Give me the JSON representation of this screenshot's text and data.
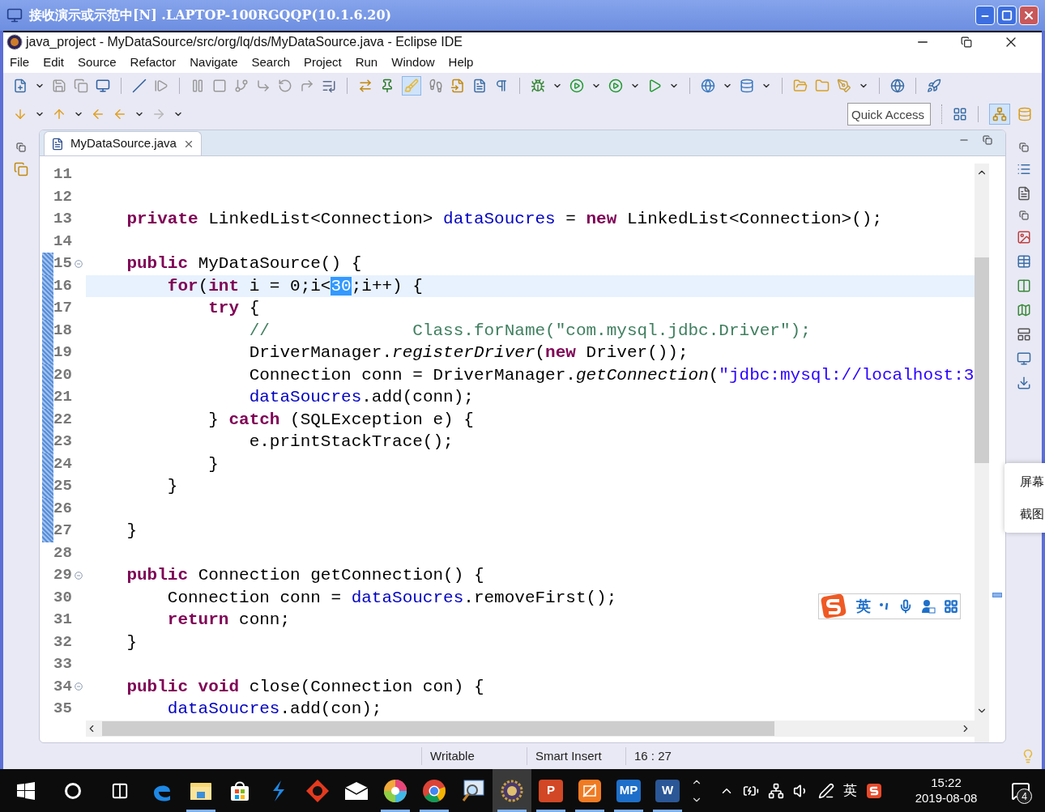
{
  "remote_title": "接收演示或示范中[N] .LAPTOP-100RGQQP(10.1.6.20)",
  "window": {
    "title": "java_project - MyDataSource/src/org/lq/ds/MyDataSource.java - Eclipse IDE"
  },
  "menu": [
    "File",
    "Edit",
    "Source",
    "Refactor",
    "Navigate",
    "Search",
    "Project",
    "Run",
    "Window",
    "Help"
  ],
  "highlight_toggle": {
    "on": true
  },
  "quick_access": {
    "placeholder": "Quick Access"
  },
  "editor_tab": {
    "label": "MyDataSource.java",
    "selected": true
  },
  "code": {
    "lines": [
      {
        "number": "11",
        "changed": false,
        "foldable": false,
        "current": false
      },
      {
        "number": "12",
        "changed": false,
        "foldable": false,
        "current": false
      },
      {
        "number": "13",
        "changed": false,
        "foldable": false,
        "current": false,
        "tokens": [
          {
            "kind": "kw",
            "text": "    private"
          },
          {
            "kind": "plain",
            "text": " LinkedList<Connection> "
          },
          {
            "kind": "field",
            "text": "dataSoucres"
          },
          {
            "kind": "plain",
            "text": " = "
          },
          {
            "kind": "kw",
            "text": "new"
          },
          {
            "kind": "plain",
            "text": " LinkedList<Connection>();"
          }
        ]
      },
      {
        "number": "14",
        "changed": false,
        "foldable": false,
        "current": false
      },
      {
        "number": "15",
        "changed": true,
        "foldable": true,
        "current": false,
        "tokens": [
          {
            "kind": "kw",
            "text": "    public"
          },
          {
            "kind": "plain",
            "text": " MyDataSource() {"
          }
        ]
      },
      {
        "number": "16",
        "changed": true,
        "foldable": false,
        "current": true,
        "tokens": [
          {
            "kind": "kw",
            "text": "        for"
          },
          {
            "kind": "plain",
            "text": "("
          },
          {
            "kind": "kw",
            "text": "int"
          },
          {
            "kind": "plain",
            "text": " i = 0;i<"
          },
          {
            "kind": "sel",
            "text": "30"
          },
          {
            "kind": "plain",
            "text": ";i++) {"
          }
        ]
      },
      {
        "number": "17",
        "changed": true,
        "foldable": false,
        "current": false,
        "tokens": [
          {
            "kind": "kw",
            "text": "            try"
          },
          {
            "kind": "plain",
            "text": " {"
          }
        ]
      },
      {
        "number": "18",
        "changed": true,
        "foldable": false,
        "current": false,
        "tokens": [
          {
            "kind": "comment",
            "text": "                //              Class.forName(\"com.mysql.jdbc.Driver\");"
          }
        ]
      },
      {
        "number": "19",
        "changed": true,
        "foldable": false,
        "current": false,
        "tokens": [
          {
            "kind": "plain",
            "text": "                DriverManager."
          },
          {
            "kind": "italic",
            "text": "registerDriver"
          },
          {
            "kind": "plain",
            "text": "("
          },
          {
            "kind": "kw",
            "text": "new"
          },
          {
            "kind": "plain",
            "text": " Driver());"
          }
        ]
      },
      {
        "number": "20",
        "changed": true,
        "foldable": false,
        "current": false,
        "tokens": [
          {
            "kind": "plain",
            "text": "                Connection conn = DriverManager."
          },
          {
            "kind": "italic",
            "text": "getConnection"
          },
          {
            "kind": "plain",
            "text": "("
          },
          {
            "kind": "str",
            "text": "\"jdbc:mysql://localhost:3"
          }
        ]
      },
      {
        "number": "21",
        "changed": true,
        "foldable": false,
        "current": false,
        "tokens": [
          {
            "kind": "field",
            "text": "                dataSoucres"
          },
          {
            "kind": "plain",
            "text": ".add(conn);"
          }
        ]
      },
      {
        "number": "22",
        "changed": true,
        "foldable": false,
        "current": false,
        "tokens": [
          {
            "kind": "plain",
            "text": "            } "
          },
          {
            "kind": "kw",
            "text": "catch"
          },
          {
            "kind": "plain",
            "text": " (SQLException e) {"
          }
        ]
      },
      {
        "number": "23",
        "changed": true,
        "foldable": false,
        "current": false,
        "tokens": [
          {
            "kind": "plain",
            "text": "                e.printStackTrace();"
          }
        ]
      },
      {
        "number": "24",
        "changed": true,
        "foldable": false,
        "current": false,
        "tokens": [
          {
            "kind": "plain",
            "text": "            }"
          }
        ]
      },
      {
        "number": "25",
        "changed": true,
        "foldable": false,
        "current": false,
        "tokens": [
          {
            "kind": "plain",
            "text": "        }"
          }
        ]
      },
      {
        "number": "26",
        "changed": true,
        "foldable": false,
        "current": false
      },
      {
        "number": "27",
        "changed": true,
        "foldable": false,
        "current": false,
        "tokens": [
          {
            "kind": "plain",
            "text": "    }"
          }
        ]
      },
      {
        "number": "28",
        "changed": false,
        "foldable": false,
        "current": false
      },
      {
        "number": "29",
        "changed": false,
        "foldable": true,
        "current": false,
        "tokens": [
          {
            "kind": "kw",
            "text": "    public"
          },
          {
            "kind": "plain",
            "text": " Connection getConnection() {"
          }
        ]
      },
      {
        "number": "30",
        "changed": false,
        "foldable": false,
        "current": false,
        "tokens": [
          {
            "kind": "plain",
            "text": "        Connection conn = "
          },
          {
            "kind": "field",
            "text": "dataSoucres"
          },
          {
            "kind": "plain",
            "text": ".removeFirst();"
          }
        ]
      },
      {
        "number": "31",
        "changed": false,
        "foldable": false,
        "current": false,
        "tokens": [
          {
            "kind": "kw",
            "text": "        return"
          },
          {
            "kind": "plain",
            "text": " conn;"
          }
        ]
      },
      {
        "number": "32",
        "changed": false,
        "foldable": false,
        "current": false,
        "tokens": [
          {
            "kind": "plain",
            "text": "    }"
          }
        ]
      },
      {
        "number": "33",
        "changed": false,
        "foldable": false,
        "current": false
      },
      {
        "number": "34",
        "changed": false,
        "foldable": true,
        "current": false,
        "tokens": [
          {
            "kind": "kw",
            "text": "    public void"
          },
          {
            "kind": "plain",
            "text": " close(Connection con) {"
          }
        ]
      },
      {
        "number": "35",
        "changed": false,
        "foldable": false,
        "current": false,
        "tokens": [
          {
            "kind": "field",
            "text": "        dataSoucres"
          },
          {
            "kind": "plain",
            "text": ".add(con);"
          }
        ]
      }
    ]
  },
  "status_bar": [
    "Writable",
    "Smart Insert",
    "16 : 27"
  ],
  "ime_toolbar": {
    "mode": "英"
  },
  "side_popup": [
    "屏幕",
    "截图"
  ],
  "taskbar": {
    "apps": [
      {
        "kind": "edge",
        "running": false,
        "selected": false
      },
      {
        "kind": "folder",
        "running": true,
        "selected": false
      },
      {
        "kind": "store",
        "running": false,
        "selected": false
      },
      {
        "kind": "bolt",
        "running": false,
        "selected": false
      },
      {
        "kind": "badge",
        "running": false,
        "selected": false
      },
      {
        "kind": "mail",
        "running": false,
        "selected": false
      },
      {
        "kind": "pinwheel",
        "running": true,
        "selected": false
      },
      {
        "kind": "chrome",
        "running": true,
        "selected": false
      },
      {
        "kind": "viewer",
        "running": false,
        "selected": false
      },
      {
        "kind": "eclipse",
        "running": true,
        "selected": true
      },
      {
        "kind": "letter",
        "label": "P",
        "color": "#d24726",
        "running": true,
        "selected": false
      },
      {
        "kind": "pdf",
        "running": true,
        "selected": false
      },
      {
        "kind": "letter",
        "label": "MP",
        "color": "#1e6fc9",
        "running": true,
        "selected": false
      },
      {
        "kind": "letter",
        "label": "W",
        "color": "#2b5797",
        "running": true,
        "selected": false
      }
    ],
    "input_language": "英",
    "time": "15:22",
    "date": "2019-08-08",
    "notifications": "4"
  }
}
